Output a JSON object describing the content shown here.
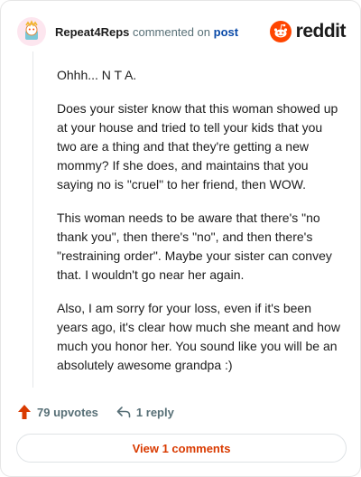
{
  "header": {
    "username": "Repeat4Reps",
    "action_text": "commented on",
    "target_text": "post",
    "brand_name": "reddit"
  },
  "comment": {
    "paragraphs": [
      "Ohhh... N T A.",
      "Does your sister know that this woman showed up at your house and tried to tell your kids that you two are a thing and that they're getting a new mommy? If she does, and maintains that you saying no is \"cruel\" to her friend, then WOW.",
      "This woman needs to be aware that there's \"no thank you\", then there's \"no\", and then there's \"restraining order\". Maybe your sister can convey that. I wouldn't go near her again.",
      "Also, I am sorry for your loss, even if it's been years ago, it's clear how much she meant and how much you honor her. You sound like you will be an absolutely awesome grandpa :)"
    ]
  },
  "actions": {
    "upvotes_label": "79 upvotes",
    "reply_label": "1 reply",
    "view_comments_label": "View 1 comments"
  },
  "colors": {
    "reddit_orange": "#ff4500",
    "upvote_arrow": "#d93a00",
    "post_link": "#0a4aa8",
    "muted_text": "#576f76"
  },
  "icons": {
    "avatar": "snoo-avatar-icon",
    "brand": "reddit-logo-icon",
    "upvote": "upvote-arrow-icon",
    "reply": "reply-arrow-icon"
  }
}
